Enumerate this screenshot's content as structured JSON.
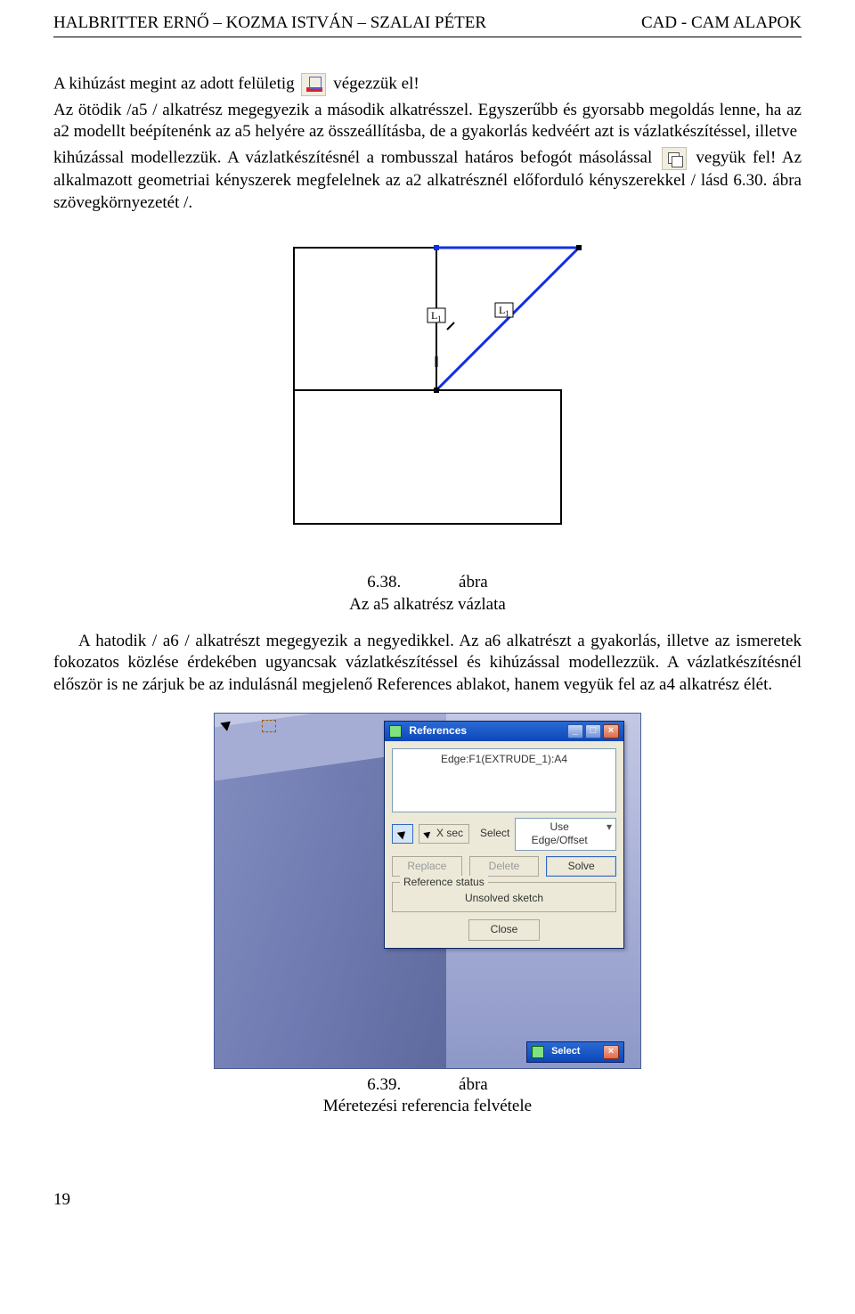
{
  "header": {
    "left": "HALBRITTER ERNŐ – KOZMA ISTVÁN – SZALAI PÉTER",
    "right": "CAD - CAM ALAPOK"
  },
  "p1_a": "A kihúzást megint az adott felületig ",
  "p1_b": " végezzük el!",
  "p2": "Az ötödik /a5 / alkatrész megegyezik a második alkatrésszel. Egyszerűbb és gyorsabb megoldás lenne, ha az a2 modellt beépítenénk az a5 helyére az összeállításba, de a gyakorlás kedvéért azt is vázlatkészítéssel, illetve",
  "p3_a": "kihúzással modellezzük. A vázlatkészítésnél a rombusszal határos befogót másolással ",
  "p3_b": " vegyük fel! Az alkalmazott geometriai kényszerek megfelelnek az a2 alkatrésznél előforduló kényszerekkel / lásd 6.30. ábra szövegkörnyezetét /.",
  "fig1": {
    "num": "6.38.",
    "word": "ábra",
    "caption": "Az a5 alkatrész vázlata",
    "label_left": "L₁",
    "label_right": "L₁"
  },
  "p4": "A hatodik / a6 / alkatrészt megegyezik a negyedikkel. Az a6 alkatrészt a gyakorlás, illetve az ismeretek fokozatos közlése érdekében ugyancsak vázlatkészítéssel és kihúzással modellezzük. A vázlatkészítésnél először is ne zárjuk be az indulásnál megjelenő References ablakot, hanem vegyük fel az a4 alkatrész élét.",
  "dialog": {
    "title": "References",
    "list_item": "Edge:F1(EXTRUDE_1):A4",
    "xsec": "X sec",
    "select_label": "Select",
    "combo_value": "Use Edge/Offset",
    "btn_replace": "Replace",
    "btn_delete": "Delete",
    "btn_solve": "Solve",
    "group_title": "Reference status",
    "status_text": "Unsolved sketch",
    "btn_close": "Close",
    "select_pal_title": "Select"
  },
  "fig2": {
    "num": "6.39.",
    "word": "ábra",
    "caption": "Méretezési referencia felvétele"
  },
  "page_num": "19"
}
